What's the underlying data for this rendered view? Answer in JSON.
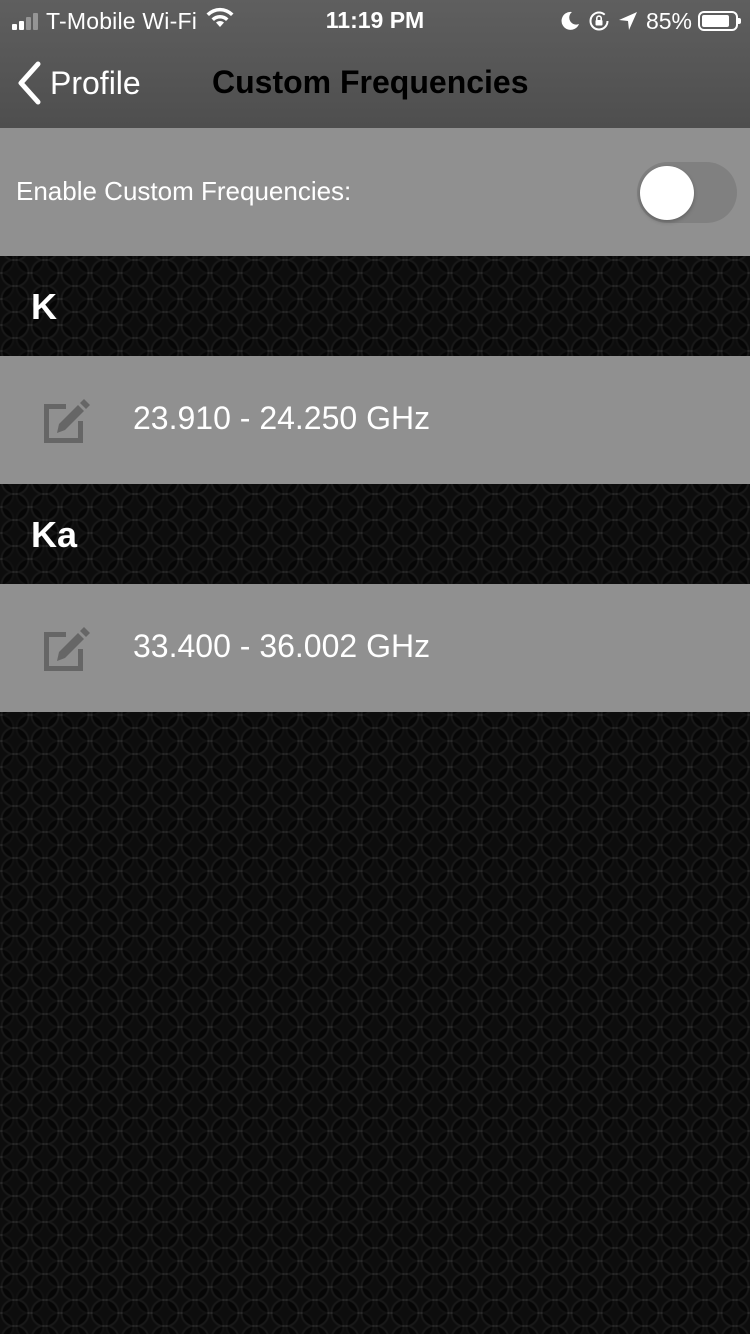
{
  "status_bar": {
    "carrier": "T-Mobile Wi-Fi",
    "time": "11:19 PM",
    "battery_percent": "85%",
    "battery_level": 0.85,
    "signal_bars": 2,
    "icons": [
      "signal-icon",
      "wifi-icon",
      "moon-icon",
      "rotation-lock-icon",
      "location-arrow-icon",
      "battery-icon"
    ]
  },
  "nav": {
    "back_label": "Profile",
    "title": "Custom Frequencies"
  },
  "settings": {
    "enable_label": "Enable Custom Frequencies:",
    "enabled": false
  },
  "sections": [
    {
      "band": "K",
      "ranges": [
        "23.910 - 24.250 GHz"
      ]
    },
    {
      "band": "Ka",
      "ranges": [
        "33.400 - 36.002 GHz"
      ]
    }
  ],
  "colors": {
    "header_bg": "#575757",
    "row_bg": "#909090",
    "page_bg": "#1d1d1d",
    "icon_color": "#666666",
    "text_light": "#ffffff"
  }
}
